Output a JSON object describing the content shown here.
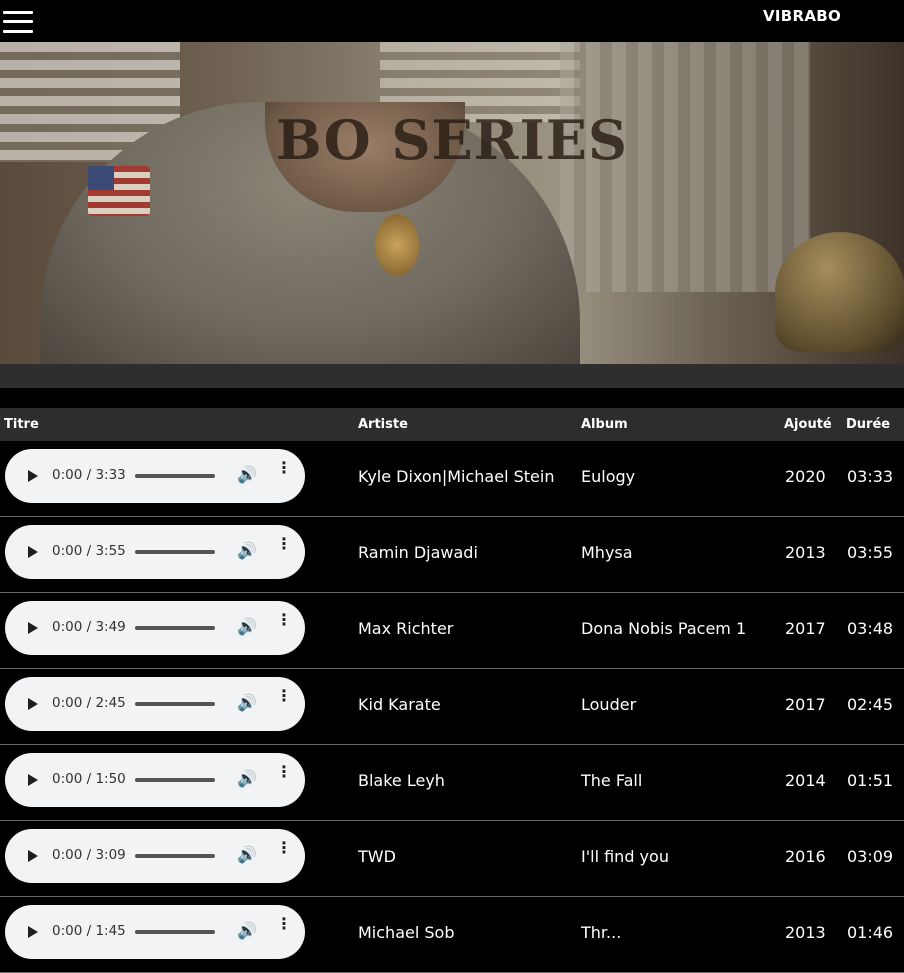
{
  "header": {
    "menu_icon": "hamburger-menu-icon",
    "brand": "VIBRABO"
  },
  "hero": {
    "title": "BO SERIES"
  },
  "table": {
    "columns": [
      "Titre",
      "Artiste",
      "Album",
      "Ajouté",
      "Durée"
    ],
    "rows": [
      {
        "player_time": "0:00 / 3:33",
        "artist": "Kyle Dixon|Michael Stein",
        "album": "Eulogy",
        "added": "2020",
        "duration": "03:33"
      },
      {
        "player_time": "0:00 / 3:55",
        "artist": "Ramin Djawadi",
        "album": "Mhysa",
        "added": "2013",
        "duration": "03:55"
      },
      {
        "player_time": "0:00 / 3:49",
        "artist": "Max Richter",
        "album": "Dona Nobis Pacem 1",
        "added": "2017",
        "duration": "03:48"
      },
      {
        "player_time": "0:00 / 2:45",
        "artist": "Kid Karate",
        "album": "Louder",
        "added": "2017",
        "duration": "02:45"
      },
      {
        "player_time": "0:00 / 1:50",
        "artist": "Blake Leyh",
        "album": "The Fall",
        "added": "2014",
        "duration": "01:51"
      },
      {
        "player_time": "0:00 / 3:09",
        "artist": "TWD",
        "album": "I'll find you",
        "added": "2016",
        "duration": "03:09"
      },
      {
        "player_time": "0:00 / 1:45",
        "artist": "Michael Sob",
        "album": "Thr...",
        "added": "2013",
        "duration": "01:46"
      }
    ]
  },
  "icons": {
    "play": "play-icon",
    "volume": "volume-icon",
    "more": "more-options-icon"
  },
  "colors": {
    "background": "#000000",
    "header_row": "#2d2d2d",
    "player": "#f1f3f4"
  }
}
